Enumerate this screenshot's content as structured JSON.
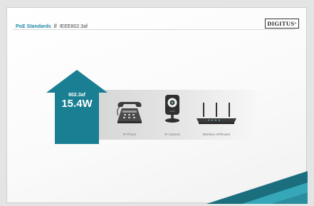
{
  "header": {
    "title": "PoE Standards",
    "separator": "//",
    "subtitle": "IEEE802.3af"
  },
  "logo": {
    "text": "DIGITUS",
    "mark": "®"
  },
  "arrow": {
    "standard": "802.3af",
    "power": "15.4W",
    "color": "#1a7f92"
  },
  "devices": [
    {
      "label": "IP Phone",
      "icon": "ip-phone-icon"
    },
    {
      "label": "IP Camera",
      "icon": "ip-camera-icon"
    },
    {
      "label": "Wireless AP/Router",
      "icon": "wireless-router-icon"
    }
  ],
  "colors": {
    "accent": "#1d8aa8",
    "corner_dark": "#1a6e7d",
    "corner_light": "#36a7b8"
  }
}
